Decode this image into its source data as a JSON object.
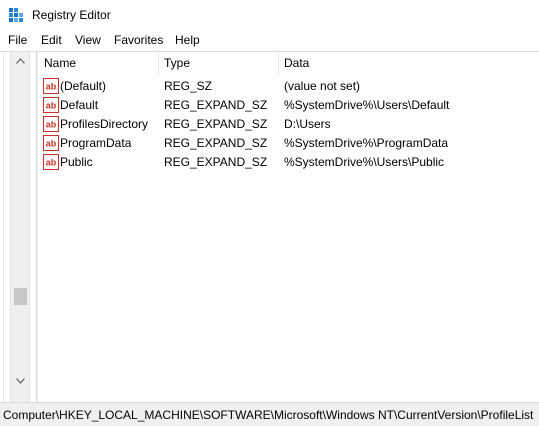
{
  "window": {
    "title": "Registry Editor"
  },
  "menu": [
    "File",
    "Edit",
    "View",
    "Favorites",
    "Help"
  ],
  "columns": {
    "name": "Name",
    "type": "Type",
    "data": "Data"
  },
  "rows": [
    {
      "name": "(Default)",
      "type": "REG_SZ",
      "data": "(value not set)",
      "icon": "string-value-icon"
    },
    {
      "name": "Default",
      "type": "REG_EXPAND_SZ",
      "data": "%SystemDrive%\\Users\\Default",
      "icon": "string-value-icon"
    },
    {
      "name": "ProfilesDirectory",
      "type": "REG_EXPAND_SZ",
      "data": "D:\\Users",
      "icon": "string-value-icon"
    },
    {
      "name": "ProgramData",
      "type": "REG_EXPAND_SZ",
      "data": "%SystemDrive%\\ProgramData",
      "icon": "string-value-icon"
    },
    {
      "name": "Public",
      "type": "REG_EXPAND_SZ",
      "data": "%SystemDrive%\\Users\\Public",
      "icon": "string-value-icon"
    }
  ],
  "status": {
    "path": "Computer\\HKEY_LOCAL_MACHINE\\SOFTWARE\\Microsoft\\Windows NT\\CurrentVersion\\ProfileList"
  },
  "colors": {
    "icon_red": "#c8322a",
    "chrome": "#f0f0f0",
    "accent_blue": "#1e73be"
  }
}
